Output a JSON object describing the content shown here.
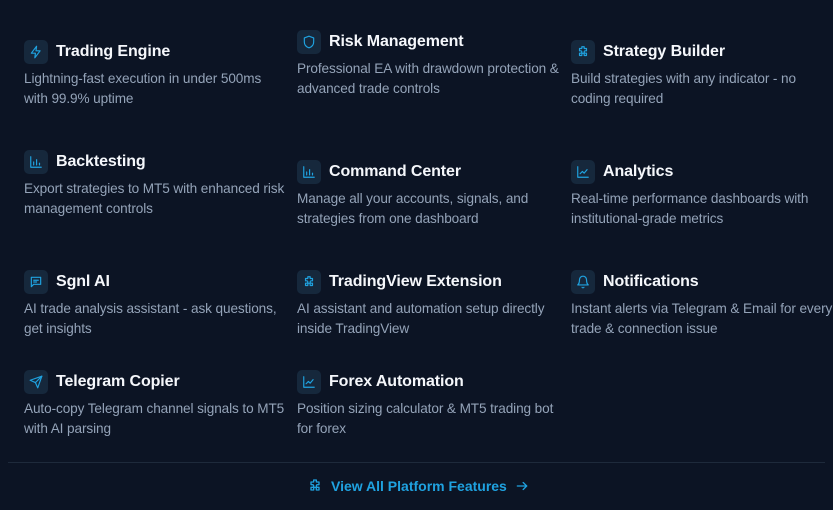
{
  "colors": {
    "background": "#0c1424",
    "icon_background": "#16283c",
    "accent": "#1fa2e0",
    "title": "#f5f7fb",
    "description": "#94a3b8"
  },
  "features": [
    {
      "icon": "lightning-icon",
      "title": "Trading Engine",
      "description": "Lightning-fast execution in under 500ms with 99.9% uptime"
    },
    {
      "icon": "shield-icon",
      "title": "Risk Management",
      "description": "Professional EA with drawdown protection & advanced trade controls"
    },
    {
      "icon": "puzzle-icon",
      "title": "Strategy Builder",
      "description": "Build strategies with any indicator - no coding required"
    },
    {
      "icon": "bar-chart-icon",
      "title": "Backtesting",
      "description": "Export strategies to MT5 with enhanced risk management controls"
    },
    {
      "icon": "bar-chart-icon",
      "title": "Command Center",
      "description": "Manage all your accounts, signals, and strategies from one dashboard"
    },
    {
      "icon": "line-chart-icon",
      "title": "Analytics",
      "description": "Real-time performance dashboards with institutional-grade metrics"
    },
    {
      "icon": "chat-icon",
      "title": "Sgnl AI",
      "description": "AI trade analysis assistant - ask questions, get insights"
    },
    {
      "icon": "puzzle-icon",
      "title": "TradingView Extension",
      "description": "AI assistant and automation setup directly inside TradingView"
    },
    {
      "icon": "bell-icon",
      "title": "Notifications",
      "description": "Instant alerts via Telegram & Email for every trade & connection issue"
    },
    {
      "icon": "send-icon",
      "title": "Telegram Copier",
      "description": "Auto-copy Telegram channel signals to MT5 with AI parsing"
    },
    {
      "icon": "line-chart-icon",
      "title": "Forex Automation",
      "description": "Position sizing calculator & MT5 trading bot for forex"
    }
  ],
  "cta": {
    "label": "View All Platform Features",
    "icon": "puzzle-icon",
    "trailing_icon": "arrow-right-icon"
  }
}
